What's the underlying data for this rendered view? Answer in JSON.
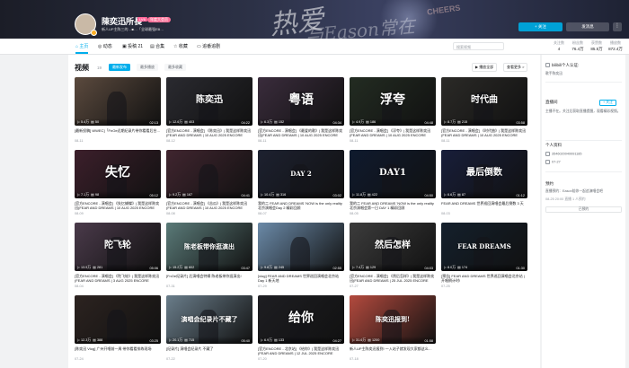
{
  "header": {
    "banner_text_1": "热爱",
    "banner_text_2": "与Eason常在",
    "banner_text_3": "CHEERS",
    "username": "陳奕迅所長",
    "level": "LV6",
    "vip_badge": "年度大会员",
    "bio": "新人UP主陈三的…■…「全球最强Elli…",
    "follow_label": "+ 关注",
    "message_label": "发消息",
    "more_label": "⋮"
  },
  "nav": {
    "tabs": [
      {
        "label": "主页",
        "icon": "home-icon"
      },
      {
        "label": "动态",
        "icon": "dynamic-icon"
      },
      {
        "label": "投稿 21",
        "icon": "upload-icon"
      },
      {
        "label": "合集",
        "icon": "collection-icon"
      },
      {
        "label": "收藏",
        "icon": "star-icon"
      },
      {
        "label": "追番追剧",
        "icon": "tv-icon"
      }
    ],
    "search_placeholder": "搜索视频",
    "stats": [
      {
        "key": "关注数",
        "value": "4"
      },
      {
        "key": "粉丝数",
        "value": "76.4万"
      },
      {
        "key": "获赞数",
        "value": "85.5万"
      },
      {
        "key": "播放数",
        "value": "872.4万"
      }
    ]
  },
  "videos": {
    "title": "视频",
    "count": "19",
    "sort_options": [
      "最新发布",
      "最多播放",
      "最多收藏"
    ],
    "play_all": "▶ 播放全部",
    "more": "查看更多 >",
    "items": [
      {
        "title": "[最新投稿] WWEC]「FnOe近期纪录片带你看看后台…",
        "date": "08-11",
        "plays": "5.4万",
        "danmaku": "50",
        "duration": "02:13",
        "big": "",
        "color": "#5b4a3e"
      },
      {
        "title": "[官方ENCORE - 演唱会] 《陈奕迅》| 我是这样陈奕迅(FEAR AND DREAMS | 10 AUG 2025 ENCORE",
        "date": "08-12",
        "plays": "12.6万",
        "danmaku": "403",
        "duration": "04:22",
        "big": "陈奕迅",
        "color": "#2a2a30"
      },
      {
        "title": "[官方ENCORE - 演唱会] 《最爱的歌》| 我是这样陈奕迅(FEAR AND DREAMS | 10 AUG 2025 ENCORE",
        "date": "08-11",
        "plays": "6.3万",
        "danmaku": "152",
        "duration": "04:34",
        "big": "粤语",
        "color": "#3a2c3c"
      },
      {
        "title": "[官方ENCORE - 演唱会] 《浮夸》| 我是这样陈奕迅(FEAR AND DREAMS | 10 AUG 2025 ENCORE",
        "date": "08-11",
        "plays": "4.9万",
        "danmaku": "186",
        "duration": "04:48",
        "big": "浮夸",
        "color": "#232c22"
      },
      {
        "title": "[官方ENCORE - 演唱会] 《时代曲》| 我是这样陈奕迅(FEAR AND DREAMS | 10 AUG 2025 ENCORE",
        "date": "08-11",
        "plays": "8.7万",
        "danmaku": "215",
        "duration": "03:58",
        "big": "时代曲",
        "color": "#2b2a27"
      },
      {
        "title": "[官方ENCORE - 演唱会] 《失忆蝴蝶》| 我是这样陈奕迅(FEAR AND DREAMS | 10 AUG 2025 ENCORE",
        "date": "08-09",
        "plays": "7.1万",
        "danmaku": "98",
        "duration": "05:12",
        "big": "失忆",
        "color": "#3c1f2b"
      },
      {
        "title": "[官方ENCORE - 演唱会] 《苦瓜》| 我是这样陈奕迅(FEAR AND DREAMS | 10 AUG 2025 ENCORE",
        "date": "08-08",
        "plays": "9.2万",
        "danmaku": "167",
        "duration": "04:41",
        "big": "",
        "color": "#40252f"
      },
      {
        "title": "我的二 FEAR AND DREAMS 'NOW is the only reality 北京演唱会Day 2 精彩回顾",
        "date": "08-07",
        "plays": "10.4万",
        "danmaku": "316",
        "duration": "03:02",
        "big": "DAY 2",
        "color": "#1d2130"
      },
      {
        "title": "我的二 FEAR AND DREAMS 'NOW is the only reality 北京演唱会第一日 DAY 1 精彩回顾",
        "date": "08-05",
        "plays": "11.8万",
        "danmaku": "422",
        "duration": "04:50",
        "big": "DAY1",
        "color": "#0f1a2e"
      },
      {
        "title": "FEAR AND DREAMS 世界巡回演唱会最后倒数 3 天",
        "date": "08-03",
        "plays": "6.6万",
        "danmaku": "87",
        "duration": "01:12",
        "big": "最后倒数",
        "color": "#181e3a"
      },
      {
        "title": "[官方ENCORE - 演唱会] 《陀飞轮》| 我是这样陈奕迅(FEAR AND DREAMS | 3 AUG 2025 ENCORE",
        "date": "08-04",
        "plays": "13.5万",
        "danmaku": "281",
        "duration": "05:06",
        "big": "陀飞轮",
        "color": "#4a3a4a"
      },
      {
        "title": "[FnOe纪录片] 后演唱会特辑 陈老板带你逛演出!",
        "date": "07-31",
        "plays": "15.2万",
        "danmaku": "602",
        "duration": "03:47",
        "big": "陈老板带你逛演出",
        "color": "#5a7a78"
      },
      {
        "title": "[vlog] FEAR AND DREAMS 世界巡回演唱会北京站 Day 1 新天地",
        "date": "07-29",
        "plays": "9.8万",
        "danmaku": "245",
        "duration": "02:55",
        "big": "",
        "color": "#6b8aa8"
      },
      {
        "title": "[官方ENCORE - 演唱会] 《然后怎样》| 我是这样陈奕迅(FEAR AND DREAMS | 25 JUL 2025 ENCORE",
        "date": "07-27",
        "plays": "7.4万",
        "danmaku": "129",
        "duration": "04:03",
        "big": "然后怎样",
        "color": "#3c3c3c"
      },
      {
        "title": "[预告] FEAR AND DREAMS 世界巡回演唱会北京站 | 开唱倒计时!",
        "date": "07-25",
        "plays": "8.0万",
        "danmaku": "174",
        "duration": "01:30",
        "big": "FEAR DREAMS",
        "color": "#14202c"
      },
      {
        "title": "[陈奕迅 Vlog] 广州开唱前一周 带你看看排练现场",
        "date": "07-24",
        "plays": "12.3万",
        "danmaku": "388",
        "duration": "03:25",
        "big": "",
        "color": "#2c2320"
      },
      {
        "title": "[纪录片] 演唱会纪录片 不藏了",
        "date": "07-22",
        "plays": "20.1万",
        "danmaku": "715",
        "duration": "05:40",
        "big": "演唱会纪录片不藏了",
        "color": "#6a7d8a"
      },
      {
        "title": "[官方ENCORE - 北京站] 《给你》| 我是这样陈奕迅(FEAR AND DREAMS | 12 JUL 2025 ENCORE",
        "date": "07-20",
        "plays": "6.9万",
        "danmaku": "133",
        "duration": "04:27",
        "big": "给你",
        "color": "#1e1e22"
      },
      {
        "title": "新人UP主陈奕迅报到! 一入站子就发现大家都这么…",
        "date": "07-18",
        "plays": "31.6万",
        "danmaku": "1200",
        "duration": "01:58",
        "big": "陈奕迅报到!",
        "color": "#b34a3e"
      }
    ]
  },
  "side": {
    "auth_title": "bilibili个人认证:",
    "auth_text": "歌手陈奕迅",
    "announce_title": "直播间",
    "announce_text": "主播不在。关注后获取直播提醒，观看精彩视频。",
    "announce_button": "+ 关注",
    "profile_title": "个人资料",
    "uid": "3546020049991185",
    "birthday": "07-27",
    "booking_title": "预约",
    "booking_text": "直播预约：Eason陪你一起追演唱会吧",
    "booking_date": "08-25 20:00 直播 1 人预约",
    "booking_button": "已预约",
    "series_title": "Eason陪你一起追演唱会吧"
  }
}
